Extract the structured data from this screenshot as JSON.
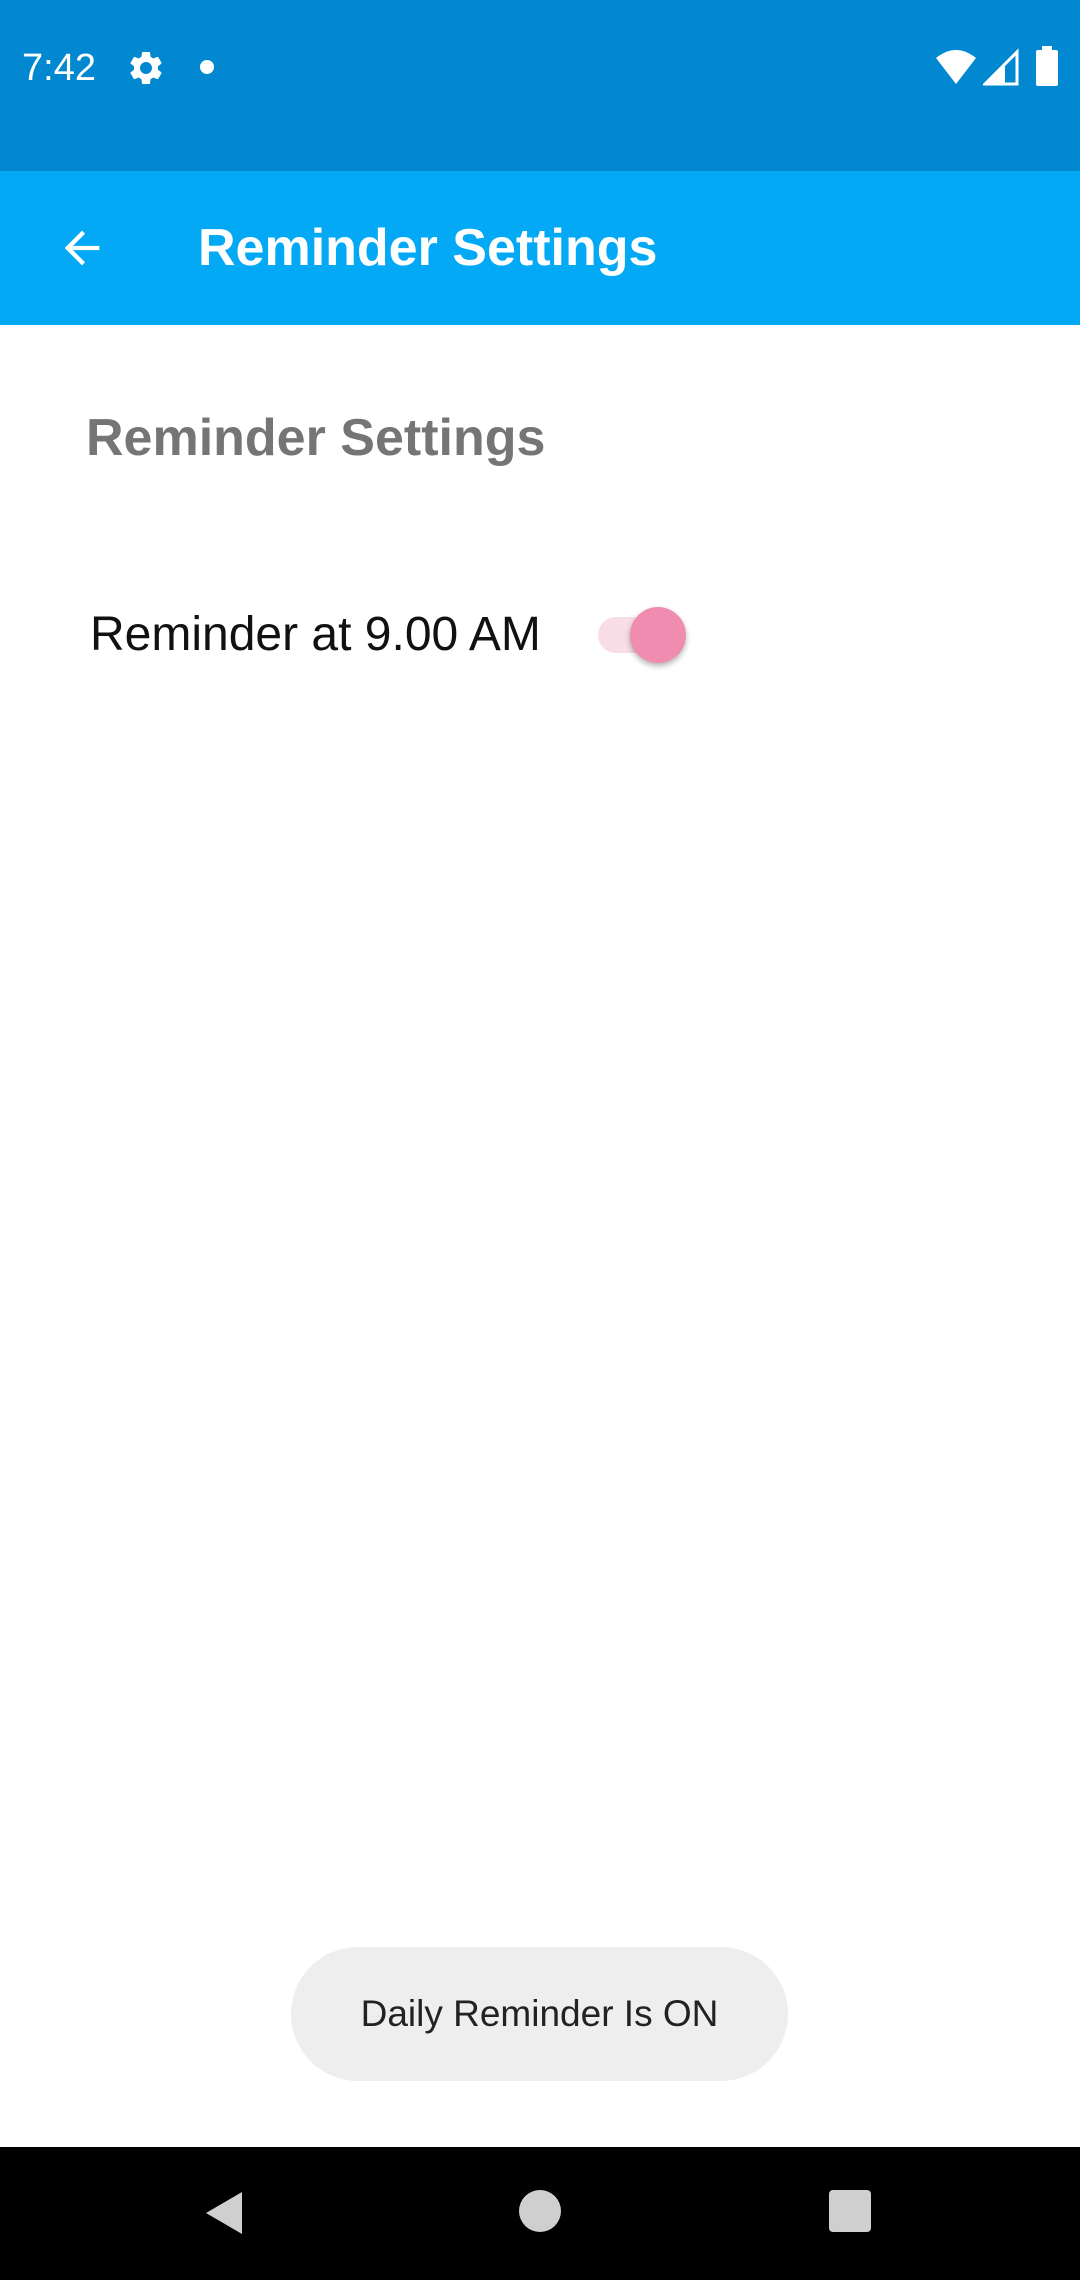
{
  "status_bar": {
    "time": "7:42",
    "icons": [
      "settings-icon",
      "notification-dot-icon",
      "wifi-icon",
      "signal-icon",
      "battery-icon"
    ],
    "color": "#0288d1"
  },
  "app_bar": {
    "title": "Reminder Settings",
    "back_icon": "arrow-back-icon",
    "color": "#03a9f4"
  },
  "content": {
    "section_title": "Reminder Settings",
    "reminder": {
      "label": "Reminder at 9.00 AM",
      "enabled": true,
      "accent_color": "#f08caf"
    }
  },
  "toast": {
    "message": "Daily Reminder Is ON"
  },
  "nav_bar": {
    "icons": [
      "nav-back-icon",
      "nav-home-icon",
      "nav-recents-icon"
    ]
  }
}
